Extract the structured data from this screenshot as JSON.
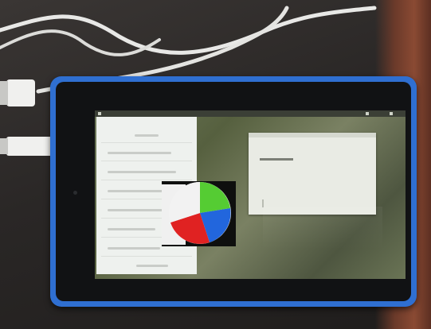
{
  "scene": {
    "description_tags": [
      "tablet-device",
      "usb-cables",
      "color-wheel-app"
    ],
    "colors": {
      "tablet_case": "#2f6fd1",
      "cable": "#e8e8e6",
      "table": "#2b2928"
    }
  },
  "wheel": {
    "segments": [
      {
        "name": "green",
        "color": "#55cc33"
      },
      {
        "name": "blue",
        "color": "#2266dd"
      },
      {
        "name": "red",
        "color": "#e02222"
      },
      {
        "name": "white",
        "color": "#f2f2f2"
      }
    ]
  },
  "left_pane": {
    "item_count": 8
  }
}
